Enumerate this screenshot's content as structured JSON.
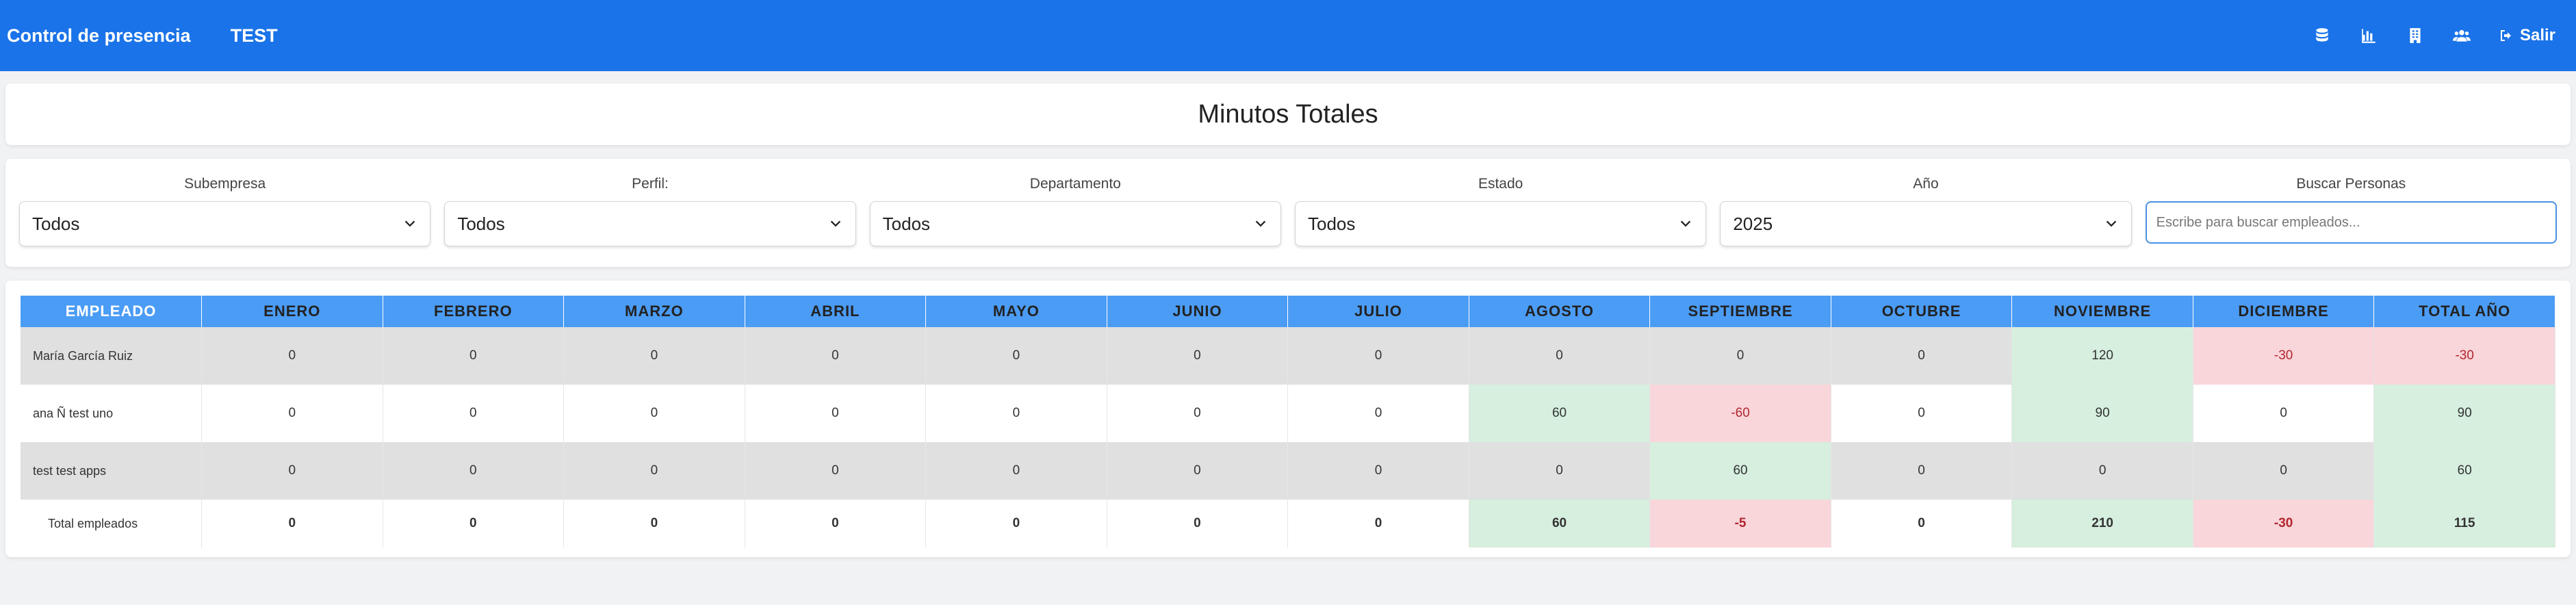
{
  "navbar": {
    "brand": "Control de presencia",
    "link": "TEST",
    "logout_label": "Salir",
    "icons": [
      "database-icon",
      "chart-icon",
      "building-icon",
      "users-icon"
    ]
  },
  "page": {
    "title": "Minutos Totales"
  },
  "filters": {
    "subempresa": {
      "label": "Subempresa",
      "value": "Todos"
    },
    "perfil": {
      "label": "Perfil:",
      "value": "Todos"
    },
    "departamento": {
      "label": "Departamento",
      "value": "Todos"
    },
    "estado": {
      "label": "Estado",
      "value": "Todos"
    },
    "anio": {
      "label": "Año",
      "value": "2025"
    },
    "buscar": {
      "label": "Buscar Personas",
      "placeholder": "Escribe para buscar empleados..."
    }
  },
  "table": {
    "headers": [
      "EMPLEADO",
      "ENERO",
      "FEBRERO",
      "MARZO",
      "ABRIL",
      "MAYO",
      "JUNIO",
      "JULIO",
      "AGOSTO",
      "SEPTIEMBRE",
      "OCTUBRE",
      "NOVIEMBRE",
      "DICIEMBRE",
      "TOTAL AÑO"
    ],
    "rows": [
      [
        "María García Ruiz",
        "0",
        "0",
        "0",
        "0",
        "0",
        "0",
        "0",
        "0",
        "0",
        "0",
        "120",
        "-30",
        "-30"
      ],
      [
        "ana Ñ test uno",
        "0",
        "0",
        "0",
        "0",
        "0",
        "0",
        "0",
        "60",
        "-60",
        "0",
        "90",
        "0",
        "90"
      ],
      [
        "test test apps",
        "0",
        "0",
        "0",
        "0",
        "0",
        "0",
        "0",
        "0",
        "60",
        "0",
        "0",
        "0",
        "60"
      ]
    ],
    "total": [
      "Total empleados",
      "0",
      "0",
      "0",
      "0",
      "0",
      "0",
      "0",
      "60",
      "-5",
      "0",
      "210",
      "-30",
      "115"
    ]
  },
  "colors": {
    "navbar": "#1a73e8",
    "header": "#4b9cf5",
    "positive": "#d6efdf",
    "negative": "#f8d6da"
  }
}
